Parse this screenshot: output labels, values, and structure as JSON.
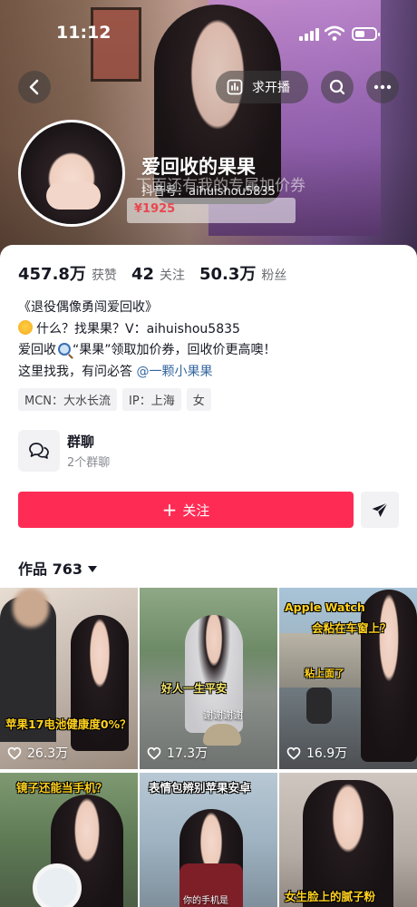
{
  "status_bar": {
    "time": "11:12"
  },
  "header": {
    "live_button_label": "求开播",
    "nickname": "爱回收的果果",
    "douyin_id": "抖音号：aihuishou5835",
    "ghost_text": "下面还有我的专属加价券",
    "ghost_price": "¥1925"
  },
  "stats": {
    "likes_value": "457.8万",
    "likes_label": "获赞",
    "following_value": "42",
    "following_label": "关注",
    "fans_value": "50.3万",
    "fans_label": "粉丝"
  },
  "bio": {
    "line1": "《退役偶像勇闯爱回收》",
    "line2": "什么？找果果？V：aihuishou5835",
    "line3_a": "爱回收",
    "line3_b": "“果果”领取加价券，回收价更高噢！",
    "line4_a": "这里找我，有问必答 ",
    "line4_mention": "@一颗小果果"
  },
  "tags": [
    "MCN：大水长流",
    "IP：上海",
    "女"
  ],
  "group_chat": {
    "title": "群聊",
    "subtitle": "2个群聊"
  },
  "actions": {
    "follow_label": "关注"
  },
  "works": {
    "label": "作品 763"
  },
  "videos": [
    {
      "caption": "苹果17电池健康度0%？",
      "likes": "26.3万"
    },
    {
      "caption": "好人一生平安",
      "caption2": "谢谢谢谢",
      "likes": "17.3万"
    },
    {
      "caption": "Apple Watch",
      "caption2": "会粘在车窗上？",
      "caption3": "粘上面了",
      "likes": "16.9万"
    },
    {
      "caption": "镜子还能当手机？",
      "likes": ""
    },
    {
      "caption": "表情包辨别苹果安卓",
      "caption2": "你的手机是",
      "likes": ""
    },
    {
      "caption": "女生脸上的腻子粉",
      "likes": ""
    }
  ],
  "colors": {
    "accent": "#fe2c55",
    "mention": "#3466a0",
    "caption_yellow": "#ffd21e"
  }
}
